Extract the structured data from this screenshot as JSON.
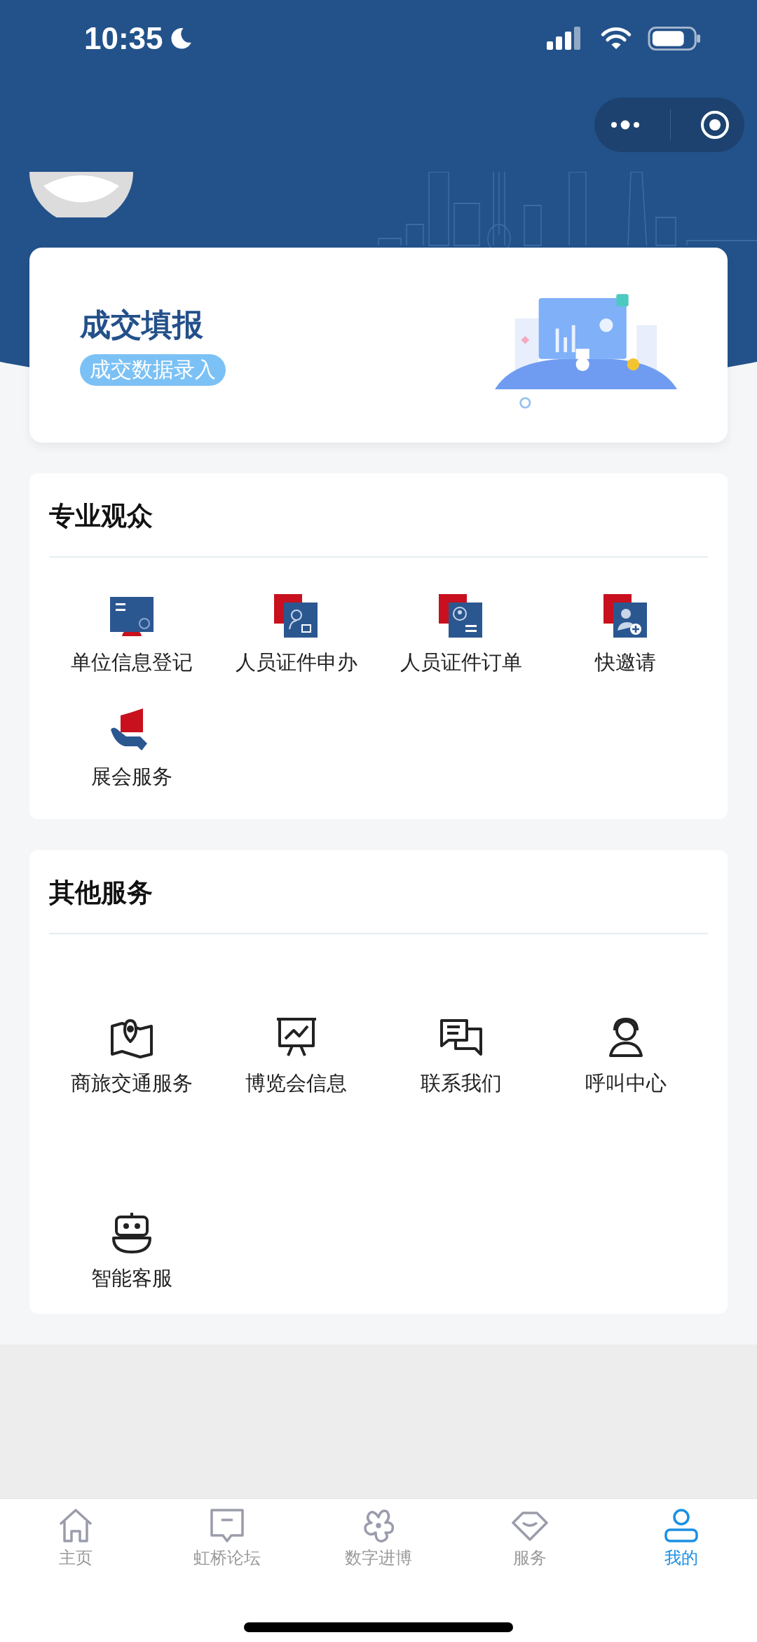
{
  "status_bar": {
    "time": "10:35"
  },
  "deal_card": {
    "title": "成交填报",
    "badge": "成交数据录入"
  },
  "sections": [
    {
      "title": "专业观众",
      "kind": "color",
      "items": [
        {
          "label": "单位信息登记"
        },
        {
          "label": "人员证件申办"
        },
        {
          "label": "人员证件订单"
        },
        {
          "label": "快邀请"
        },
        {
          "label": "展会服务"
        }
      ]
    },
    {
      "title": "其他服务",
      "kind": "outline",
      "items": [
        {
          "label": "商旅交通服务"
        },
        {
          "label": "博览会信息"
        },
        {
          "label": "联系我们"
        },
        {
          "label": "呼叫中心"
        },
        {
          "label": "智能客服"
        }
      ]
    }
  ],
  "tab_bar": [
    {
      "label": "主页",
      "selected": false
    },
    {
      "label": "虹桥论坛",
      "selected": false
    },
    {
      "label": "数字进博",
      "selected": false
    },
    {
      "label": "服务",
      "selected": false
    },
    {
      "label": "我的",
      "selected": true
    }
  ]
}
